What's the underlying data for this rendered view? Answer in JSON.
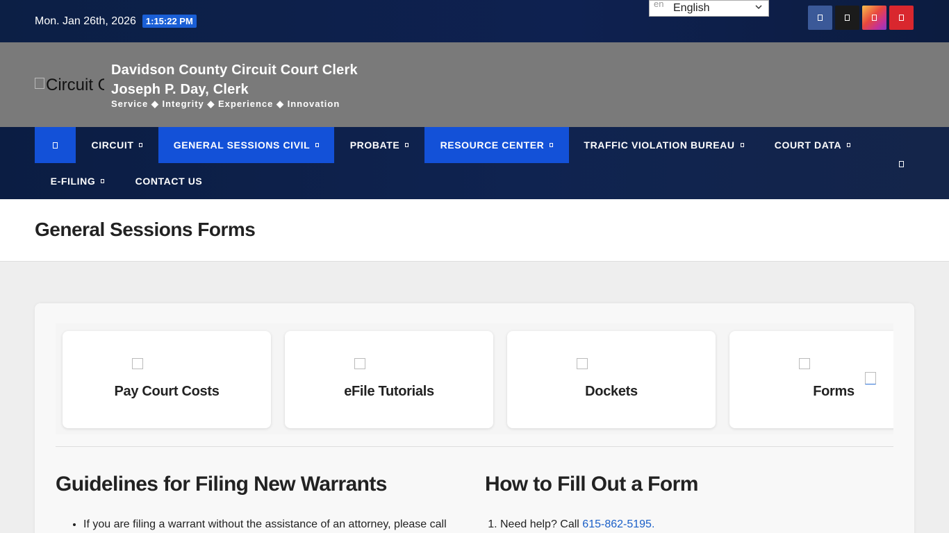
{
  "topbar": {
    "date": "Mon. Jan 26th, 2026",
    "time": "1:15:22 PM",
    "language": {
      "flag_alt": "en",
      "selected": "English"
    },
    "socials": [
      {
        "name": "facebook",
        "icon": "facebook-icon",
        "color": "#3b5998"
      },
      {
        "name": "x",
        "icon": "x-icon",
        "color": "#1b1b1b"
      },
      {
        "name": "instagram",
        "icon": "instagram-icon",
        "color": "#e8473e"
      },
      {
        "name": "youtube",
        "icon": "youtube-icon",
        "color": "#d9272e"
      }
    ]
  },
  "header": {
    "logo_alt": "Circuit Court Clerk",
    "title": "Davidson County Circuit Court Clerk",
    "subtitle": "Joseph P. Day, Clerk",
    "tagline": "Service ◆ Integrity ◆ Experience ◆ Innovation",
    "background": "#7a7a7a"
  },
  "nav": {
    "accent": "#1351d8",
    "items": [
      {
        "label": "",
        "icon": "home-icon"
      },
      {
        "label": "CIRCUIT"
      },
      {
        "label": "GENERAL SESSIONS CIVIL"
      },
      {
        "label": "PROBATE"
      },
      {
        "label": "RESOURCE CENTER"
      },
      {
        "label": "TRAFFIC VIOLATION BUREAU"
      },
      {
        "label": "COURT DATA"
      },
      {
        "label": "E-FILING"
      },
      {
        "label": "CONTACT US"
      }
    ],
    "search_icon": "search-icon"
  },
  "page": {
    "title": "General Sessions Forms"
  },
  "tiles": [
    {
      "label": "Pay Court Costs"
    },
    {
      "label": "eFile Tutorials"
    },
    {
      "label": "Dockets"
    },
    {
      "label": "Forms"
    }
  ],
  "sections": {
    "guidelines": {
      "heading": "Guidelines for Filing New Warrants",
      "items": [
        "If you are filing a warrant without the assistance of an attorney, please call"
      ]
    },
    "howto": {
      "heading": "How to Fill Out a Form",
      "item_prefix": "Need help? Call ",
      "phone": "615-862-5195",
      "item_suffix": "."
    }
  }
}
